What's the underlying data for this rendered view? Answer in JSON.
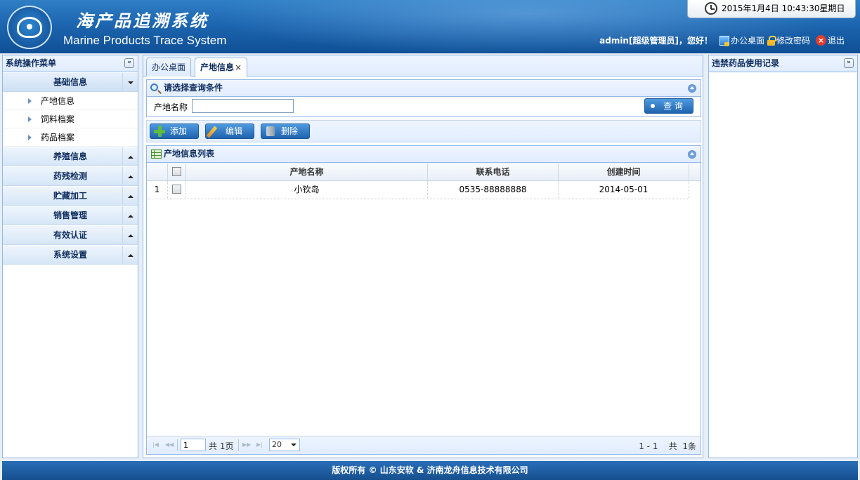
{
  "header": {
    "title_cn": "海产品追溯系统",
    "title_en": "Marine Products Trace System",
    "datetime": "2015年1月4日  10:43:30星期日",
    "welcome": "admin[超级管理员]，您好！",
    "links": {
      "desktop": "办公桌面",
      "change_password": "修改密码",
      "logout": "退出"
    }
  },
  "sidebar": {
    "title": "系统操作菜单",
    "collapse_glyph": "«",
    "groups": [
      {
        "label": "基础信息",
        "expanded": true,
        "items": [
          "产地信息",
          "饲料档案",
          "药品档案"
        ]
      },
      {
        "label": "养殖信息",
        "expanded": false
      },
      {
        "label": "药残检测",
        "expanded": false
      },
      {
        "label": "贮藏加工",
        "expanded": false
      },
      {
        "label": "销售管理",
        "expanded": false
      },
      {
        "label": "有效认证",
        "expanded": false
      },
      {
        "label": "系统设置",
        "expanded": false
      }
    ]
  },
  "tabs": [
    {
      "label": "办公桌面",
      "selected": false
    },
    {
      "label": "产地信息",
      "selected": true,
      "close": "×"
    }
  ],
  "query": {
    "title": "请选择查询条件",
    "field_label": "产地名称",
    "field_value": "",
    "search_button": "查 询"
  },
  "toolbar": {
    "add": "添加",
    "edit": "编辑",
    "delete": "删除"
  },
  "list": {
    "title": "产地信息列表",
    "columns": [
      "产地名称",
      "联系电话",
      "创建时间"
    ],
    "rows": [
      {
        "num": "1",
        "name": "小钦岛",
        "phone": "0535-88888888",
        "created": "2014-05-01"
      }
    ]
  },
  "pager": {
    "page": "1",
    "total_pages_text": "共  1页",
    "page_size": "20",
    "summary": "1 - 1    共  1条"
  },
  "right_panel": {
    "title": "违禁药品使用记录",
    "expand_glyph": "»"
  },
  "footer": {
    "text": "版权所有  © 山东安软  & 济南龙舟信息技术有限公司"
  }
}
